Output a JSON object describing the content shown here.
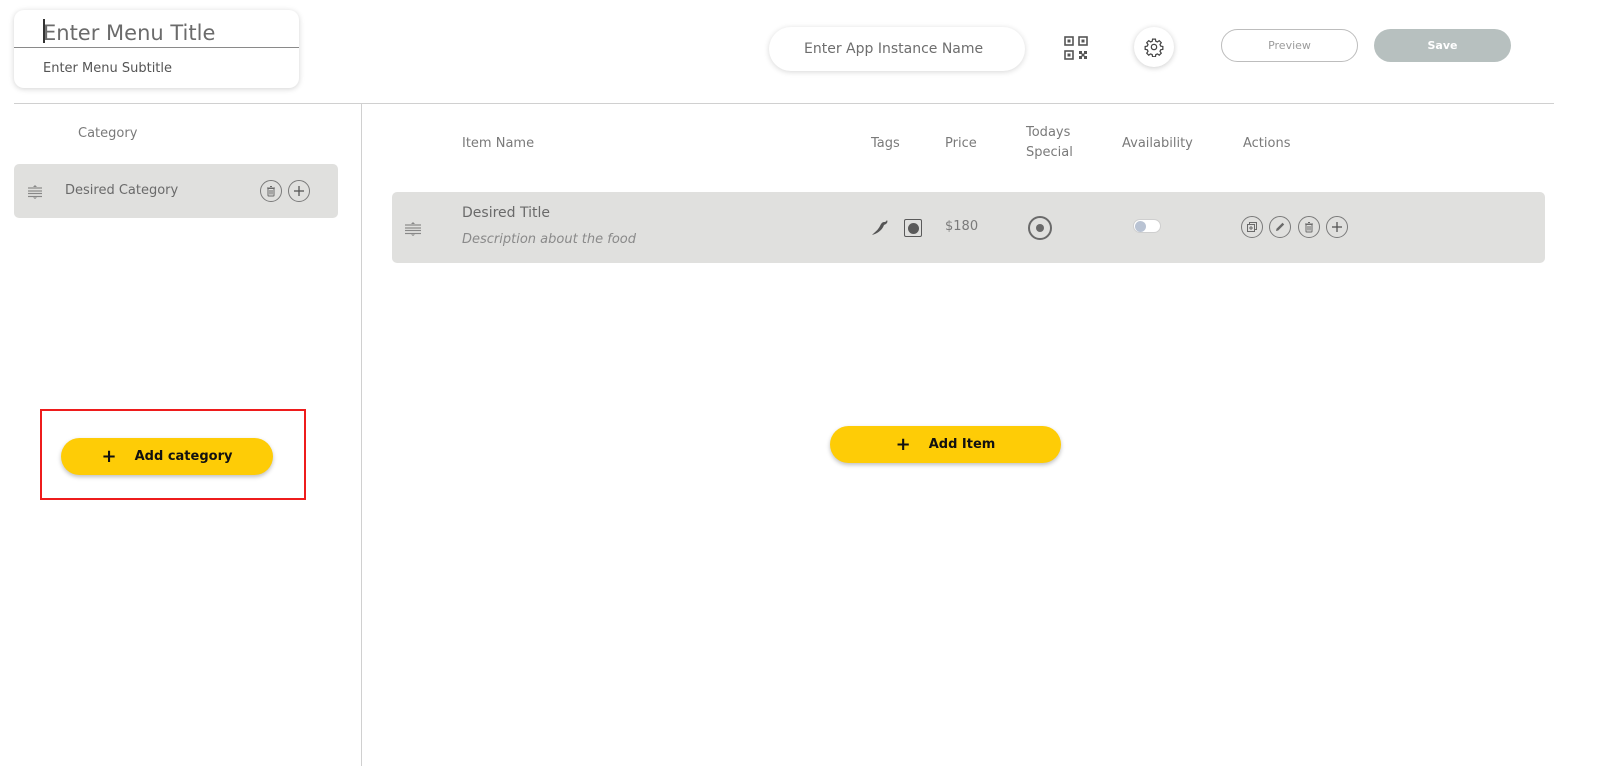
{
  "header": {
    "menu_title_placeholder": "Enter Menu Title",
    "menu_subtitle_placeholder": "Enter Menu Subtitle",
    "app_instance_placeholder": "Enter App Instance Name",
    "preview_label": "Preview",
    "save_label": "Save",
    "icons": [
      "qr-code-icon",
      "gear-icon"
    ]
  },
  "sidebar": {
    "header": "Category",
    "categories": [
      {
        "name": "Desired Category"
      }
    ],
    "add_category_label": "Add category"
  },
  "table": {
    "columns": {
      "item_name": "Item Name",
      "tags": "Tags",
      "price": "Price",
      "todays_special_line1": "Todays",
      "todays_special_line2": "Special",
      "availability": "Availability",
      "actions": "Actions"
    },
    "rows": [
      {
        "title": "Desired Title",
        "description": "Description about the food",
        "tags": [
          "chili-icon",
          "veg-icon"
        ],
        "price": "$180",
        "todays_special": true,
        "available": false
      }
    ],
    "add_item_label": "Add Item"
  },
  "colors": {
    "accent_yellow": "#fecc06",
    "save_disabled": "#b7c0bf",
    "row_background": "#e0e0de",
    "highlight_red": "#ee1c1c"
  }
}
